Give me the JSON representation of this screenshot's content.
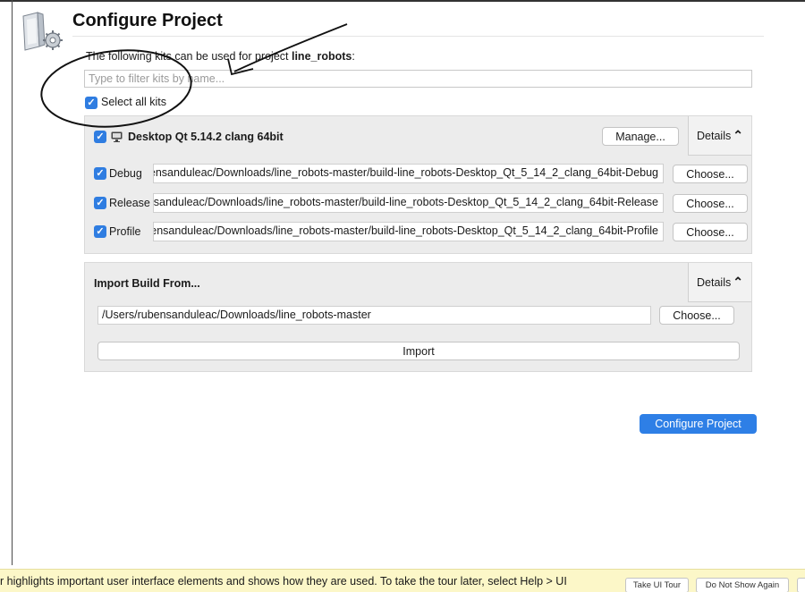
{
  "page": {
    "title": "Configure Project"
  },
  "intro": {
    "prefix": "The following kits can be used for project ",
    "project": "line_robots",
    "suffix": ":"
  },
  "filter": {
    "placeholder": "Type to filter kits by name..."
  },
  "select_all": {
    "label": "Select all kits",
    "checked": true
  },
  "kit": {
    "name": "Desktop Qt 5.14.2 clang 64bit",
    "checked": true,
    "manage_label": "Manage...",
    "details_label": "Details",
    "builds": [
      {
        "label": "Debug",
        "checked": true,
        "path": "/Users/rubensanduleac/Downloads/line_robots-master/build-line_robots-Desktop_Qt_5_14_2_clang_64bit-Debug",
        "choose_label": "Choose..."
      },
      {
        "label": "Release",
        "checked": true,
        "path": "/Users/rubensanduleac/Downloads/line_robots-master/build-line_robots-Desktop_Qt_5_14_2_clang_64bit-Release",
        "choose_label": "Choose..."
      },
      {
        "label": "Profile",
        "checked": true,
        "path": "/Users/rubensanduleac/Downloads/line_robots-master/build-line_robots-Desktop_Qt_5_14_2_clang_64bit-Profile",
        "choose_label": "Choose..."
      }
    ]
  },
  "import": {
    "title": "Import Build From...",
    "details_label": "Details",
    "path": "/Users/rubensanduleac/Downloads/line_robots-master",
    "choose_label": "Choose...",
    "import_label": "Import"
  },
  "configure_label": "Configure Project",
  "tour_bar": {
    "text": "r highlights important user interface elements and shows how they are used. To take the tour later, select Help > UI",
    "take_tour_label": "Take UI Tour",
    "dont_show_label": "Do Not Show Again"
  },
  "colors": {
    "accent": "#2f7de1",
    "button_primary": "#2e7fe6",
    "panel": "#ececec",
    "tour_bar": "#fcf7c8"
  },
  "icons": {
    "wizard": "folder-gear-icon",
    "kit": "monitor-icon",
    "details": "chevron-up-icon"
  }
}
